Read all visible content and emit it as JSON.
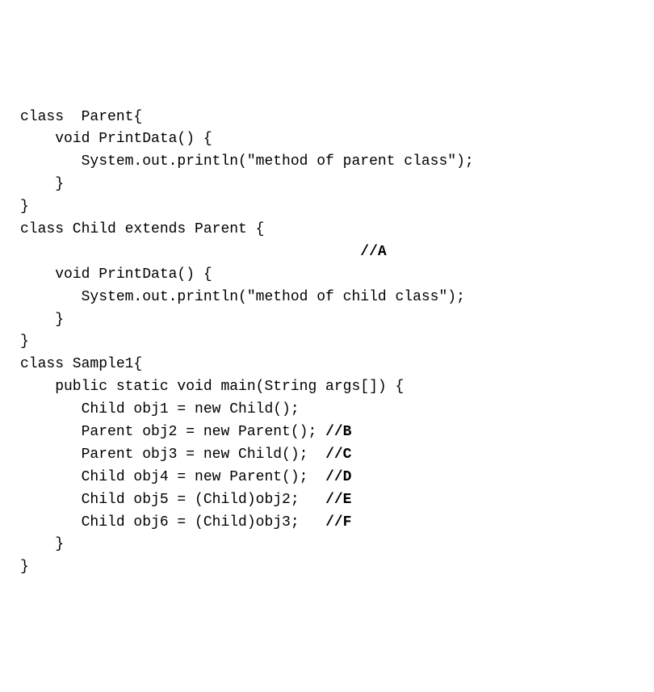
{
  "code": {
    "l1": "class  Parent{",
    "l2": "    void PrintData() {",
    "l3": "       System.out.println(\"method of parent class\");",
    "l4": "    }",
    "l5": "}",
    "l6": "",
    "l7": "class Child extends Parent {",
    "l8a": "                                       ",
    "l8b": "//A",
    "l9": "    void PrintData() {",
    "l10": "       System.out.println(\"method of child class\");",
    "l11": "    }",
    "l12": "}",
    "l13": "",
    "l14": "class Sample1{",
    "l15": "    public static void main(String args[]) {",
    "l16": "       Child obj1 = new Child();",
    "l17a": "       Parent obj2 = new Parent(); ",
    "l17b": "//B",
    "l18a": "       Parent obj3 = new Child();  ",
    "l18b": "//C",
    "l19a": "       Child obj4 = new Parent();  ",
    "l19b": "//D",
    "l20a": "       Child obj5 = (Child)obj2;   ",
    "l20b": "//E",
    "l21a": "       Child obj6 = (Child)obj3;   ",
    "l21b": "//F",
    "l22": "    }",
    "l23": "}"
  }
}
